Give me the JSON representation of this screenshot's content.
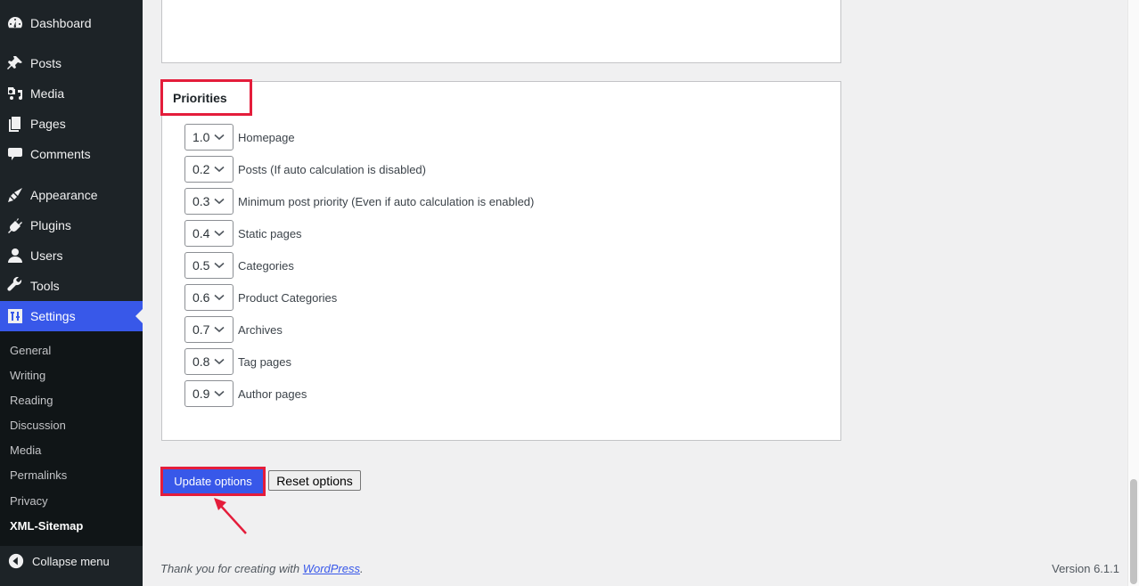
{
  "sidebar": {
    "items": [
      {
        "label": "Dashboard",
        "icon": "dashboard-icon"
      },
      {
        "label": "Posts",
        "icon": "pin-icon"
      },
      {
        "label": "Media",
        "icon": "media-icon"
      },
      {
        "label": "Pages",
        "icon": "pages-icon"
      },
      {
        "label": "Comments",
        "icon": "comment-icon"
      },
      {
        "label": "Appearance",
        "icon": "brush-icon"
      },
      {
        "label": "Plugins",
        "icon": "plugin-icon"
      },
      {
        "label": "Users",
        "icon": "user-icon"
      },
      {
        "label": "Tools",
        "icon": "wrench-icon"
      },
      {
        "label": "Settings",
        "icon": "settings-icon",
        "active": true
      }
    ],
    "submenu": [
      "General",
      "Writing",
      "Reading",
      "Discussion",
      "Media",
      "Permalinks",
      "Privacy",
      "XML-Sitemap"
    ],
    "current_submenu": "XML-Sitemap",
    "collapse_label": "Collapse menu"
  },
  "priorities": {
    "title": "Priorities",
    "rows": [
      {
        "value": "1.0",
        "label": "Homepage"
      },
      {
        "value": "0.2",
        "label": "Posts (If auto calculation is disabled)"
      },
      {
        "value": "0.3",
        "label": "Minimum post priority (Even if auto calculation is enabled)"
      },
      {
        "value": "0.4",
        "label": "Static pages"
      },
      {
        "value": "0.5",
        "label": "Categories"
      },
      {
        "value": "0.6",
        "label": "Product Categories"
      },
      {
        "value": "0.7",
        "label": "Archives"
      },
      {
        "value": "0.8",
        "label": "Tag pages"
      },
      {
        "value": "0.9",
        "label": "Author pages"
      }
    ]
  },
  "actions": {
    "update_label": "Update options",
    "reset_label": "Reset options"
  },
  "footer": {
    "thanks_prefix": "Thank you for creating with ",
    "thanks_link": "WordPress",
    "thanks_suffix": ".",
    "version": "Version 6.1.1"
  },
  "colors": {
    "accent": "#3858e9",
    "highlight": "#e41d3b",
    "sidebar_bg": "#1d2327",
    "submenu_bg": "#101517"
  }
}
